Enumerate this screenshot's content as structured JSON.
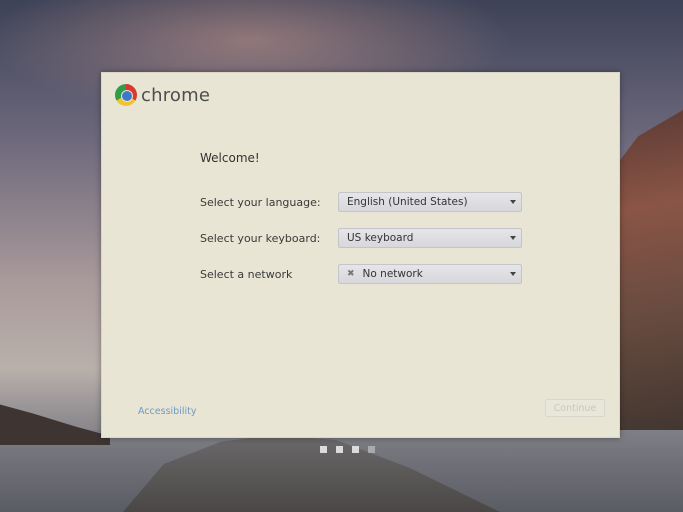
{
  "brand": {
    "name": "chrome",
    "logo_icon": "chrome-logo-icon"
  },
  "welcome": {
    "title": "Welcome!"
  },
  "form": {
    "language": {
      "label": "Select your language:",
      "value": "English (United States)"
    },
    "keyboard": {
      "label": "Select your keyboard:",
      "value": "US keyboard"
    },
    "network": {
      "label": "Select a network",
      "value": "No network",
      "icon": "no-network-icon"
    }
  },
  "footer": {
    "accessibility_label": "Accessibility",
    "continue_label": "Continue",
    "continue_enabled": false
  },
  "pager": {
    "total": 4,
    "current": 1
  },
  "colors": {
    "dialog_bg": "#e8e5d4",
    "link": "#6e9ac8"
  }
}
